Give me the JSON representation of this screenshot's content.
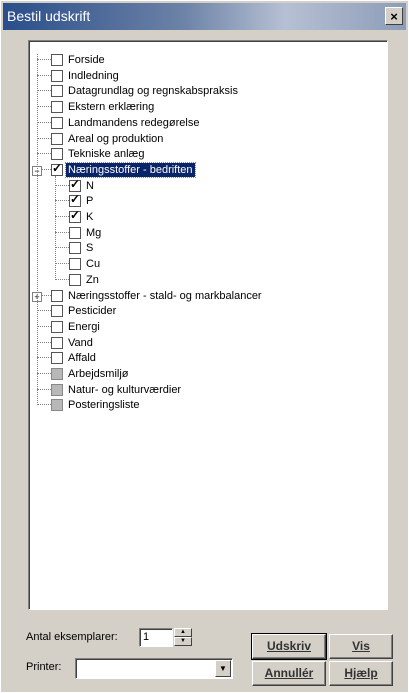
{
  "window": {
    "title": "Bestil udskrift",
    "close_label": "×"
  },
  "tree": {
    "items": [
      {
        "label": "Forside",
        "checked": false
      },
      {
        "label": "Indledning",
        "checked": false
      },
      {
        "label": "Datagrundlag og regnskabspraksis",
        "checked": false
      },
      {
        "label": "Ekstern erklæring",
        "checked": false
      },
      {
        "label": "Landmandens redegørelse",
        "checked": false
      },
      {
        "label": "Areal og produktion",
        "checked": false
      },
      {
        "label": "Tekniske anlæg",
        "checked": false
      },
      {
        "label": "Næringsstoffer  -  bedriften",
        "checked": true,
        "expander": "−",
        "selected": true
      },
      {
        "label": "N",
        "checked": true,
        "child": true
      },
      {
        "label": "P",
        "checked": true,
        "child": true
      },
      {
        "label": "K",
        "checked": true,
        "child": true
      },
      {
        "label": "Mg",
        "checked": false,
        "child": true
      },
      {
        "label": "S",
        "checked": false,
        "child": true
      },
      {
        "label": "Cu",
        "checked": false,
        "child": true
      },
      {
        "label": "Zn",
        "checked": false,
        "child": true
      },
      {
        "label": "Næringsstoffer  -  stald- og markbalancer",
        "checked": false,
        "expander": "+"
      },
      {
        "label": "Pesticider",
        "checked": false
      },
      {
        "label": "Energi",
        "checked": false
      },
      {
        "label": "Vand",
        "checked": false
      },
      {
        "label": "Affald",
        "checked": false
      },
      {
        "label": "Arbejdsmiljø",
        "checked": false,
        "disabled": true
      },
      {
        "label": "Natur- og kulturværdier",
        "checked": false,
        "disabled": true
      },
      {
        "label": "Posteringsliste",
        "checked": false,
        "disabled": true
      }
    ]
  },
  "copies": {
    "label": "Antal eksemplarer:",
    "value": "1"
  },
  "printer": {
    "label": "Printer:",
    "value": ""
  },
  "buttons": {
    "print": "Udskriv",
    "view": "Vis",
    "cancel": "Annullér",
    "help": "Hjælp"
  }
}
